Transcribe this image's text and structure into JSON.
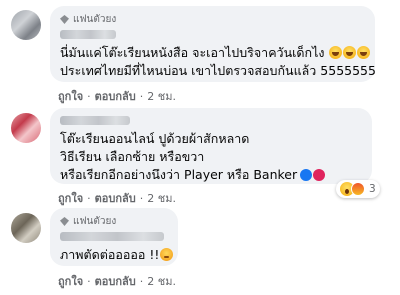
{
  "comments": [
    {
      "badge": "แฟนตัวยง",
      "lines": [
        "นี่มันแค่โต๊ะเรียนหนังสือ จะเอาไปบริจาควันเด็กไง",
        "ประเทศไทยมีที่ไหนบ่อน เขาไปตรวจสอบกันแล้ว 5555555"
      ],
      "actions": {
        "like": "ถูกใจ",
        "reply": "ตอบกลับ",
        "time": "2 ชม."
      }
    },
    {
      "lines": [
        "โต๊ะเรียนออนไลน์ ปูด้วยผ้าสักหลาด",
        "วิธีเรียน เลือกซ้าย หรือขวา",
        "หรือเรียกอีกอย่างนึงว่า Player หรือ Banker"
      ],
      "reaction_count": "3",
      "actions": {
        "like": "ถูกใจ",
        "reply": "ตอบกลับ",
        "time": "2 ชม."
      }
    },
    {
      "badge": "แฟนตัวยง",
      "lines": [
        "ภาพตัดต่อออออ !!"
      ],
      "actions": {
        "like": "ถูกใจ",
        "reply": "ตอบกลับ",
        "time": "2 ชม."
      }
    }
  ],
  "icons": {
    "badge": "diamond-icon",
    "laugh": "laughing-emoji",
    "sad": "sad-emoji",
    "reactions": [
      "wow-reaction-icon",
      "angry-reaction-icon"
    ]
  },
  "colors": {
    "bubble": "#f0f2f5",
    "meta": "#65676b",
    "text": "#050505",
    "blue": "#1877f2",
    "red": "#e0245e"
  }
}
